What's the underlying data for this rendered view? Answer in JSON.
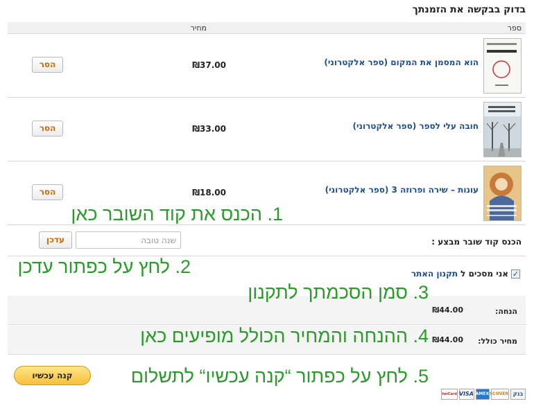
{
  "page": {
    "title": "בדוק בבקשה את הזמנתך"
  },
  "table": {
    "col_book": "ספר",
    "col_price": "מחיר"
  },
  "items": [
    {
      "title": "הוא המסמן את המקום (ספר אלקטרוני)",
      "price": "₪37.00",
      "remove_label": "הסר",
      "cover_icon": "book-cover-white"
    },
    {
      "title": "חובה עלי לספר (ספר אלקטרוני)",
      "price": "₪33.00",
      "remove_label": "הסר",
      "cover_icon": "book-cover-trees"
    },
    {
      "title": "עונות – שירה ופרוזה 3 (ספר אלקטרוני)",
      "price": "₪18.00",
      "remove_label": "הסר",
      "cover_icon": "book-cover-artnouveau"
    }
  ],
  "coupon": {
    "label": "הכנס קוד שובר מבצע :",
    "placeholder": "שנה טובה",
    "update_label": "עדכן"
  },
  "terms": {
    "prefix": "אני מסכים ל",
    "link": "תקנון האתר",
    "checked": true
  },
  "summary": {
    "discount_label": "הנחה:",
    "discount_value": "₪44.00",
    "total_label": "מחיר כולל:",
    "total_value": "₪44.00"
  },
  "buy": {
    "label": "קנה עכשיו"
  },
  "payment_logos": [
    "בנק",
    "DISCOVER",
    "AMEX",
    "VISA",
    "MasterCard"
  ],
  "annotations": {
    "a1": "1. הכנס את קוד השובר כאן",
    "a2": "2. לחץ על כפתור עדכן",
    "a3": "3. סמן הסכמתך לתקנון",
    "a4": "4. ההנחה והמחיר הכולל מופיעים כאן",
    "a5": "5. לחץ על כפתור “קנה עכשיו“ לתשלום"
  },
  "colors": {
    "link": "#1f4e8c",
    "button_text": "#d26a00",
    "annotation": "#2a9b2a",
    "buy_button": "#f7bf3a"
  }
}
